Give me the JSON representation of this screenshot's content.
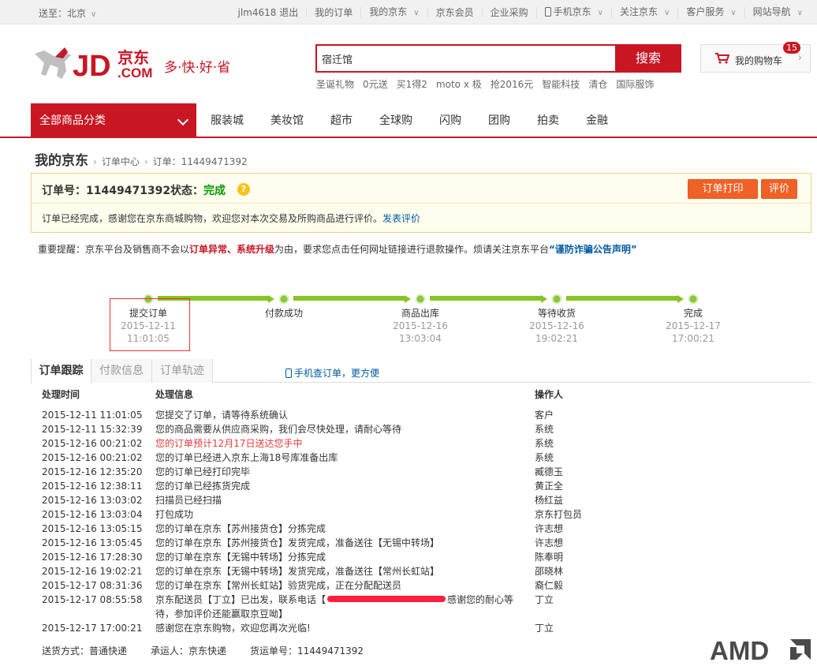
{
  "topbar": {
    "location_label": "送至：北京",
    "items": [
      {
        "label": "jlm4618  退出",
        "chevron": false,
        "phone": false
      },
      {
        "label": "我的订单",
        "chevron": false,
        "phone": false
      },
      {
        "label": "我的京东",
        "chevron": true,
        "phone": false
      },
      {
        "label": "京东会员",
        "chevron": false,
        "phone": false
      },
      {
        "label": "企业采购",
        "chevron": false,
        "phone": false
      },
      {
        "label": "手机京东",
        "chevron": true,
        "phone": true
      },
      {
        "label": "关注京东",
        "chevron": true,
        "phone": false
      },
      {
        "label": "客户服务",
        "chevron": true,
        "phone": false
      },
      {
        "label": "网站导航",
        "chevron": true,
        "phone": false
      }
    ]
  },
  "logo": {
    "brand": "JD",
    "brand_cn": "京东",
    "dotcom": ".COM",
    "slogan": "多·快·好·省"
  },
  "search": {
    "value": "宿迁馆",
    "button": "搜索",
    "hot": [
      "圣诞礼物",
      "0元送",
      "买1得2",
      "moto x 极",
      "抢2016元",
      "智能科技",
      "清仓",
      "国际服饰"
    ]
  },
  "cart": {
    "label": "我的购物车",
    "count": "15"
  },
  "nav": {
    "all_categories": "全部商品分类",
    "items": [
      "服装城",
      "美妆馆",
      "超市",
      "全球购",
      "闪购",
      "团购",
      "拍卖",
      "金融"
    ]
  },
  "breadcrumb": {
    "home": "我的京东",
    "level1": "订单中心",
    "level2": "订单：11449471392"
  },
  "order": {
    "number_label": "订单号：11449471392",
    "status_label": "状态：",
    "status_value": "完成",
    "print_button": "订单打印",
    "review_button": "评价",
    "message": "订单已经完成，感谢您在京东商城购物，欢迎您对本次交易及所购商品进行评价。",
    "message_link": "发表评价"
  },
  "notice": {
    "prefix": "重要提醒：京东平台及销售商不会以",
    "red": "订单异常、系统升级",
    "middle": "为由，要求您点击任何网址链接进行退款操作。烦请关注京东平台",
    "blue": "“谨防诈骗公告声明”"
  },
  "progress": [
    {
      "label": "提交订单",
      "date": "2015-12-11",
      "time": "11:01:05"
    },
    {
      "label": "付款成功",
      "date": "",
      "time": ""
    },
    {
      "label": "商品出库",
      "date": "2015-12-16",
      "time": "13:03:04"
    },
    {
      "label": "等待收货",
      "date": "2015-12-16",
      "time": "19:02:21"
    },
    {
      "label": "完成",
      "date": "2015-12-17",
      "time": "17:00:21"
    }
  ],
  "tabs": {
    "items": [
      "订单跟踪",
      "付款信息",
      "订单轨迹"
    ],
    "active": 0,
    "phone_link": "手机查订单，更方便"
  },
  "tracking": {
    "headers": [
      "处理时间",
      "处理信息",
      "操作人"
    ],
    "rows": [
      {
        "time": "2015-12-11 11:01:05",
        "info": "您提交了订单，请等待系统确认",
        "op": "客户"
      },
      {
        "time": "2015-12-11 15:32:39",
        "info": "您的商品需要从供应商采购，我们会尽快处理，请耐心等待",
        "op": "系统"
      },
      {
        "time": "2015-12-16 00:21:02",
        "info": "您的订单预计12月17日送达您手中",
        "op": "系统",
        "red": true
      },
      {
        "time": "2015-12-16 00:21:02",
        "info": "您的订单已经进入京东上海18号库准备出库",
        "op": "系统"
      },
      {
        "time": "2015-12-16 12:35:20",
        "info": "您的订单已经打印完毕",
        "op": "臧德玉"
      },
      {
        "time": "2015-12-16 12:38:11",
        "info": "您的订单已经拣货完成",
        "op": "黄正全"
      },
      {
        "time": "2015-12-16 13:03:02",
        "info": "扫描员已经扫描",
        "op": "杨红益"
      },
      {
        "time": "2015-12-16 13:03:04",
        "info": "打包成功",
        "op": "京东打包员"
      },
      {
        "time": "2015-12-16 13:05:15",
        "info": "您的订单在京东【苏州接货仓】分拣完成",
        "op": "许志想"
      },
      {
        "time": "2015-12-16 13:05:45",
        "info": "您的订单在京东【苏州接货仓】发货完成，准备送往【无锡中转场】",
        "op": "许志想"
      },
      {
        "time": "2015-12-16 17:28:30",
        "info": "您的订单在京东【无锡中转场】分拣完成",
        "op": "陈奉明"
      },
      {
        "time": "2015-12-16 19:02:21",
        "info": "您的订单在京东【无锡中转场】发货完成，准备送往【常州长虹站】",
        "op": "邵晓林"
      },
      {
        "time": "2015-12-17 08:31:36",
        "info": "您的订单在京东【常州长虹站】验货完成，正在分配配送员",
        "op": "裔仁毅"
      },
      {
        "time": "2015-12-17 08:55:58",
        "info": "京东配送员【丁立】已出发，联系电话【",
        "info_after": "感谢您的耐心等待，参加评价还能赢取京豆呦】",
        "redacted": true,
        "op": "丁立"
      },
      {
        "time": "2015-12-17 17:00:21",
        "info": "感谢您在京东购物，欢迎您再次光临!",
        "op": "丁立"
      }
    ]
  },
  "shipping": {
    "method": "送货方式：普通快递",
    "carrier": "承运人：京东快递",
    "waybill": "货运单号：11449471392"
  },
  "watermark": {
    "text": "AMD"
  },
  "colors": {
    "brand_red": "#c81623",
    "status_green": "#009900",
    "link_blue": "#005aa0",
    "button_orange": "#f06127",
    "progress_green": "#86c425"
  }
}
